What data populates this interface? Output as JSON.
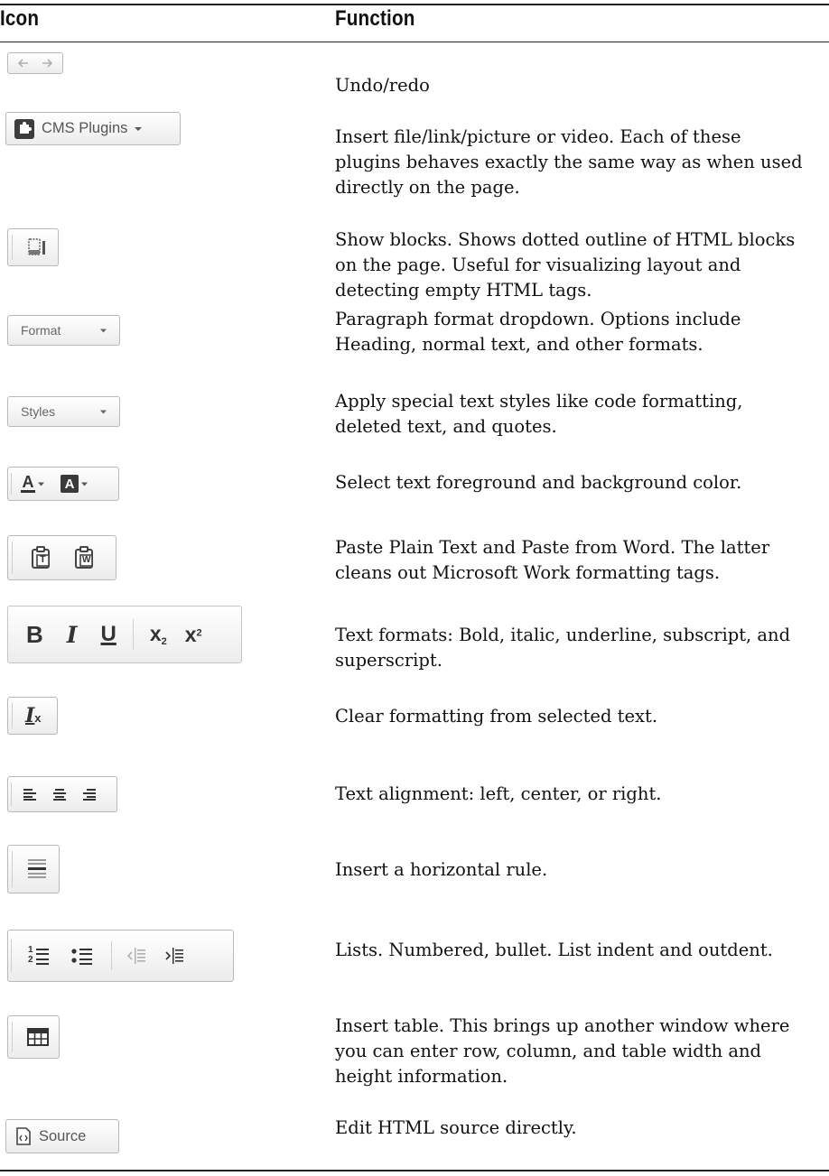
{
  "header": {
    "icon_col": "Icon",
    "function_col": "Function"
  },
  "rows": [
    {
      "id": "undo-redo",
      "icon": [
        "undo-icon",
        "redo-icon"
      ],
      "function": "Undo/redo"
    },
    {
      "id": "cms-plugins",
      "icon": [
        "puzzle-icon",
        "chevron-down-icon"
      ],
      "label": "CMS Plugins",
      "function": "Insert file/link/picture or video. Each of these plugins behaves exactly the same way as when used directly on the page."
    },
    {
      "id": "show-blocks",
      "icon": [
        "show-blocks-icon"
      ],
      "function": "Show blocks. Shows dotted outline of HTML blocks on the page. Useful for visualizing layout and detecting empty HTML tags."
    },
    {
      "id": "format",
      "icon": [
        "chevron-down-icon"
      ],
      "label": "Format",
      "function": "Paragraph format dropdown. Options include Heading, normal text, and other formats."
    },
    {
      "id": "styles",
      "icon": [
        "chevron-down-icon"
      ],
      "label": "Styles",
      "function": "Apply special text styles like code formatting, deleted text, and quotes."
    },
    {
      "id": "colors",
      "icon": [
        "text-color-icon",
        "background-color-icon"
      ],
      "glyphs": [
        "A",
        "A"
      ],
      "function": "Select text foreground and background color."
    },
    {
      "id": "paste",
      "icon": [
        "paste-text-icon",
        "paste-word-icon"
      ],
      "glyphs": [
        "T",
        "W"
      ],
      "function": "Paste Plain Text and Paste from Word. The latter cleans out Microsoft Work formatting tags."
    },
    {
      "id": "text-formats",
      "icon": [
        "bold-icon",
        "italic-icon",
        "underline-icon",
        "subscript-icon",
        "superscript-icon"
      ],
      "glyphs": [
        "B",
        "I",
        "U",
        "x",
        "2",
        "x",
        "2"
      ],
      "function": "Text formats: Bold, italic, underline, subscript, and superscript."
    },
    {
      "id": "clear-format",
      "icon": [
        "remove-format-icon"
      ],
      "glyphs": [
        "I",
        "x"
      ],
      "function": "Clear formatting from selected text."
    },
    {
      "id": "align",
      "icon": [
        "align-left-icon",
        "align-center-icon",
        "align-right-icon"
      ],
      "function": "Text alignment: left, center, or right."
    },
    {
      "id": "hrule",
      "icon": [
        "horizontal-rule-icon"
      ],
      "function": "Insert a horizontal rule."
    },
    {
      "id": "lists",
      "icon": [
        "numbered-list-icon",
        "bulleted-list-icon",
        "outdent-icon",
        "indent-icon"
      ],
      "glyphs": [
        "1",
        "2"
      ],
      "function": "Lists. Numbered, bullet. List indent and outdent."
    },
    {
      "id": "table",
      "icon": [
        "table-icon"
      ],
      "function": "Insert table. This brings up another window where you can enter row, column, and table width and height information."
    },
    {
      "id": "source",
      "icon": [
        "source-icon"
      ],
      "label": "Source",
      "function": "Edit HTML source directly."
    }
  ],
  "colors": {
    "text": "#111111",
    "rule": "#222222",
    "button_border": "#b9b9b9",
    "icon": "#333333",
    "icon_disabled": "#b0b0b0"
  }
}
